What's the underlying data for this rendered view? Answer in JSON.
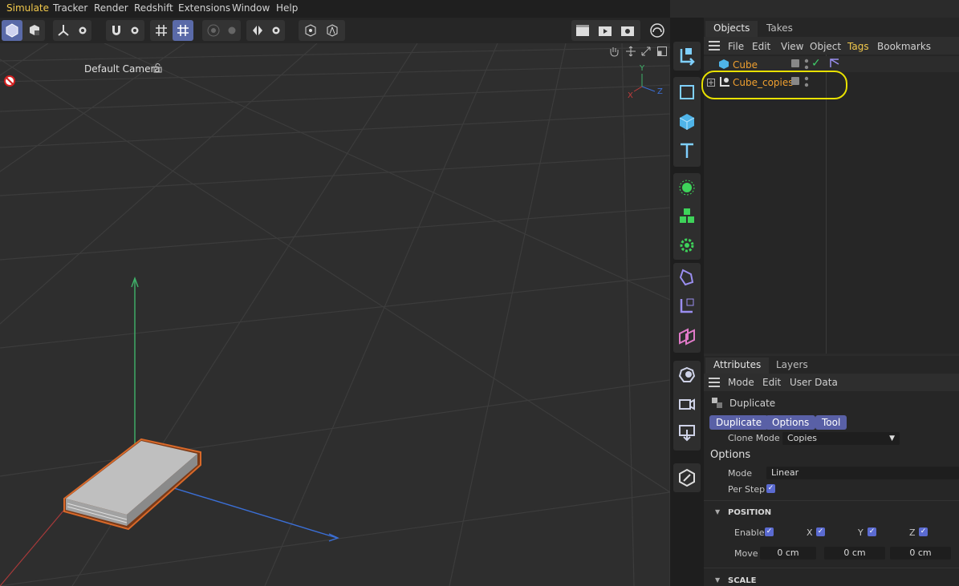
{
  "menu": [
    "Simulate",
    "Tracker",
    "Render",
    "Redshift",
    "Extensions",
    "Window",
    "Help"
  ],
  "viewport": {
    "camera_label": "Default Camera",
    "axis_labels": {
      "x": "X",
      "y": "Y",
      "z": "Z"
    }
  },
  "objects_panel": {
    "tabs": [
      "Objects",
      "Takes"
    ],
    "menu": [
      "File",
      "Edit",
      "View",
      "Object",
      "Tags",
      "Bookmarks"
    ],
    "items": [
      {
        "name": "Cube"
      },
      {
        "name": "Cube_copies"
      }
    ]
  },
  "attributes_panel": {
    "tabs": [
      "Attributes",
      "Layers"
    ],
    "menu": [
      "Mode",
      "Edit",
      "User Data"
    ],
    "object_type": "Duplicate",
    "buttons": [
      "Duplicate",
      "Options",
      "Tool"
    ],
    "clone_mode": {
      "label": "Clone Mode",
      "value": "Copies"
    },
    "section_options": "Options",
    "mode": {
      "label": "Mode",
      "value": "Linear"
    },
    "per_step": {
      "label": "Per Step"
    },
    "position": {
      "header": "POSITION",
      "enable_label": "Enable",
      "x_label": "X",
      "y_label": "Y",
      "z_label": "Z",
      "move_label": "Move",
      "move_x": "0 cm",
      "move_y": "0 cm",
      "move_z": "0 cm"
    },
    "scale_header": "SCALE"
  },
  "colors": {
    "accent": "#5960a6",
    "active_menu": "#f2c94c",
    "highlight_circle": "#e8e100",
    "object_orange": "#f0a030"
  }
}
